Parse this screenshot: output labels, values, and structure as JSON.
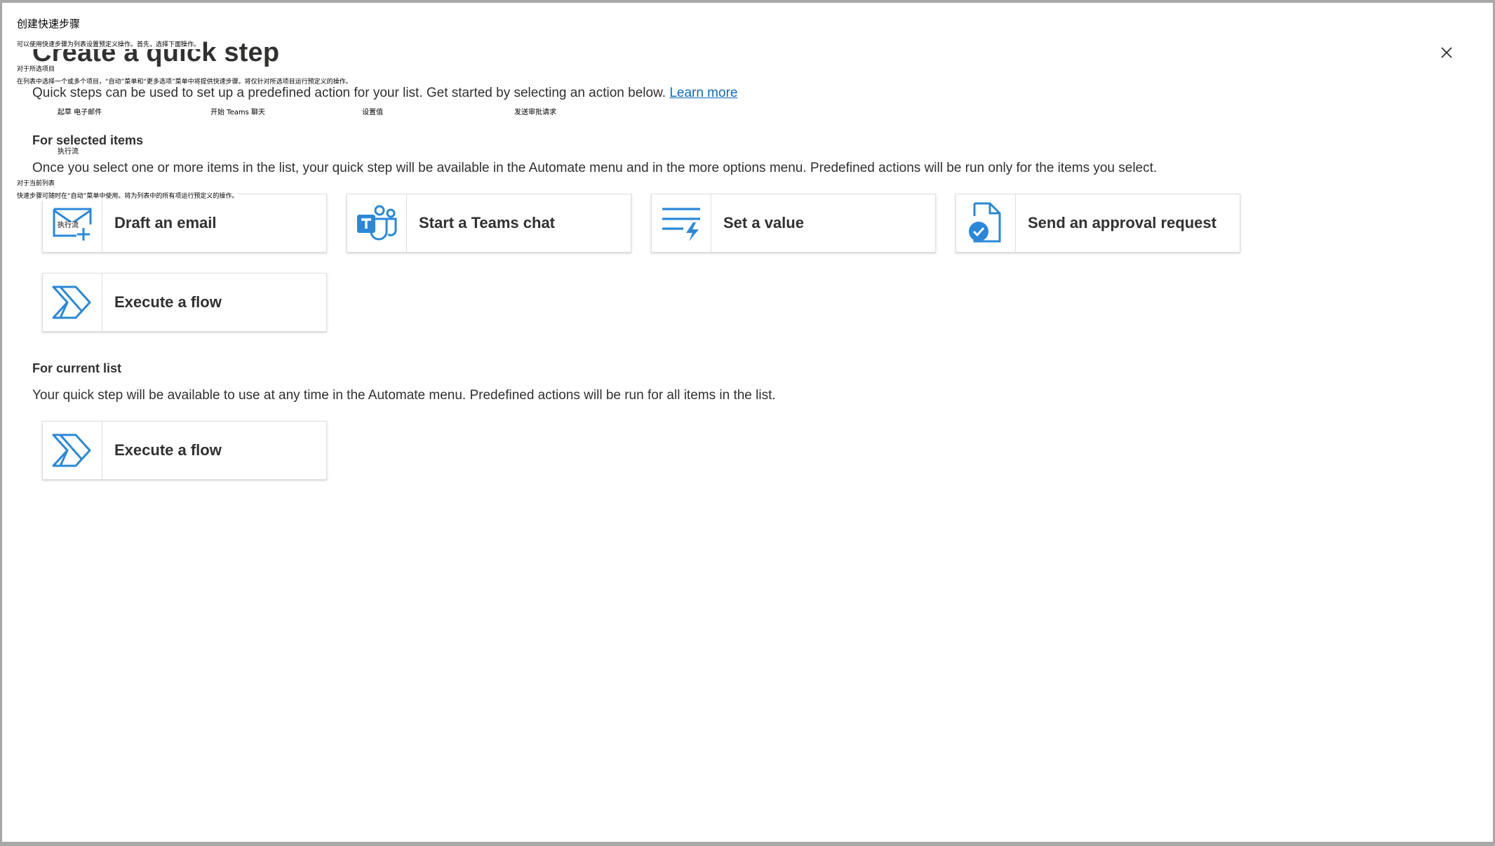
{
  "overlay": {
    "title": "创建快速步骤",
    "intro": "可以使用快速步骤为列表设置预定义操作。首先，选择下面操作。",
    "selected_heading": "对于所选项目",
    "selected_desc": "在列表中选择一个或多个项目，“自动”菜单和“更多选项”菜单中将提供快速步骤。将仅针对所选项目运行预定义的操作。",
    "card_draft": "起草 电子邮件",
    "card_teams": "开始 Teams 聊天",
    "card_value": "设置值",
    "card_approval": "发送审批请求",
    "card_flow_1": "执行流",
    "current_heading": "对于当前列表",
    "current_desc": "快速步骤可随时在“自动”菜单中使用。将为列表中的所有项运行预定义的操作。",
    "card_flow_2": "执行流"
  },
  "dialog": {
    "title": "Create a quick step",
    "description": "Quick steps can be used to set up a predefined action for your list. Get started by selecting an action below.",
    "learn_more": "Learn more",
    "close_icon": "close-icon"
  },
  "selected_section": {
    "heading": "For selected items",
    "description": "Once you select one or more items in the list, your quick step will be available in the Automate menu and in the more options menu. Predefined actions will be run only for the items you select.",
    "cards": [
      {
        "label": "Draft an email",
        "icon": "mail-add-icon"
      },
      {
        "label": "Start a Teams chat",
        "icon": "teams-icon"
      },
      {
        "label": "Set a value",
        "icon": "set-value-icon"
      },
      {
        "label": "Send an approval request",
        "icon": "approval-document-icon"
      },
      {
        "label": "Execute a flow",
        "icon": "power-automate-icon"
      }
    ]
  },
  "current_section": {
    "heading": "For current list",
    "description": "Your quick step will be available to use at any time in the Automate menu. Predefined actions will be run for all items in the list.",
    "cards": [
      {
        "label": "Execute a flow",
        "icon": "power-automate-icon"
      }
    ]
  },
  "colors": {
    "accent": "#0f6cbd",
    "icon_blue": "#2b88d8",
    "text": "#323130",
    "card_border": "#e1dfdd"
  }
}
